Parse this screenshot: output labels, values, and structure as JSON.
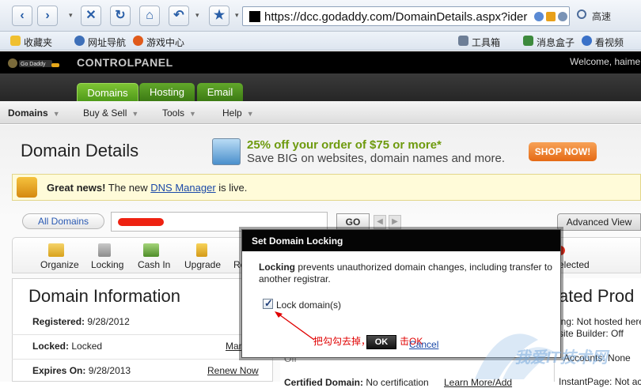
{
  "browser": {
    "url": "https://dcc.godaddy.com/DomainDetails.aspx?ider",
    "speed_label": "高速",
    "bookmarks": [
      "收藏夹",
      "网址导航",
      "游戏中心"
    ],
    "right_tools": [
      "工具箱",
      "消息盒子",
      "看视频"
    ]
  },
  "header": {
    "logo_text": "Go Daddy",
    "title": "CONTROLPANEL",
    "welcome": "Welcome, haime"
  },
  "tabs": [
    {
      "label": "Domains",
      "active": true
    },
    {
      "label": "Hosting",
      "active": false
    },
    {
      "label": "Email",
      "active": false
    }
  ],
  "menu": [
    "Domains",
    "Buy & Sell",
    "Tools",
    "Help"
  ],
  "page": {
    "title": "Domain Details",
    "promo_line1": "25% off your order of $75 or more*",
    "promo_line2": "Save BIG on websites, domain names and more.",
    "shop_now": "SHOP NOW!",
    "news_bold": "Great news!",
    "news_pre": " The new ",
    "news_link": "DNS Manager",
    "news_post": " is live.",
    "all_domains": "All Domains",
    "go": "GO",
    "advanced_view": "Advanced View"
  },
  "tools": [
    "Organize",
    "Locking",
    "Cash In",
    "Upgrade",
    "Re"
  ],
  "tools_right": "elected",
  "info": {
    "title": "Domain Information",
    "registered_label": "Registered:",
    "registered_value": "9/28/2012",
    "locked_label": "Locked:",
    "locked_value": "Locked",
    "manage_link": "Man",
    "expires_label": "Expires On:",
    "expires_value": "9/28/2013",
    "renew_link": "Renew Now"
  },
  "mid": {
    "off_text": "Off",
    "certified_label": "Certified Domain:",
    "certified_value": "No certification",
    "learn_link": "Learn More/Add"
  },
  "related": {
    "title": "ated Prod",
    "hosting": "ing: Not hosted here",
    "builder": "site Builder: Off",
    "accounts": "Accounts: None",
    "instant": "InstantPage: Not activ"
  },
  "modal": {
    "title": "Set Domain Locking",
    "desc_bold": "Locking",
    "desc_rest": " prevents unauthorized domain changes, including transfer to another registrar.",
    "checkbox_label": "Lock domain(s)",
    "checked": true,
    "ok": "OK",
    "cancel": "Cancel"
  },
  "annotation": {
    "pre": "把勾勾去掉，",
    "post": "击OK"
  },
  "watermark": "我爱IT技术网"
}
